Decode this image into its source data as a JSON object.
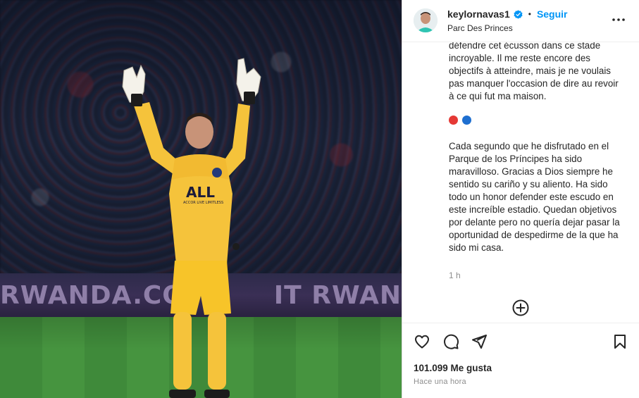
{
  "photo": {
    "banner_text": [
      "RWANDA.COM",
      "IT RWANDA"
    ],
    "shirt_sponsor": "ALL",
    "shirt_sponsor_sub": "ACCOR LIVE LIMITLESS"
  },
  "post": {
    "username": "keylornavas1",
    "separator": "•",
    "follow_label": "Seguir",
    "location": "Parc Des Princes",
    "caption": {
      "french_fragment": "encouragements. Ce fut un honneur de défendre cet écusson dans ce stade incroyable. Il me reste encore des objectifs à atteindre, mais je ne voulais pas manquer l'occasion de dire au revoir à ce qui fut ma maison.",
      "flags": [
        {
          "name": "red-circle",
          "color": "#e53935"
        },
        {
          "name": "blue-circle",
          "color": "#1e6fd0"
        }
      ],
      "spanish": "Cada segundo que he disfrutado en el Parque de los Príncipes ha sido maravilloso. Gracias a Dios siempre he sentido su cariño y su aliento. Ha sido todo un honor defender este escudo en este increíble estadio. Quedan objetivos por delante pero no quería dejar pasar la oportunidad de despedirme de la que ha sido mi casa."
    },
    "caption_age": "1 h",
    "likes": "101.099 Me gusta",
    "posted_ago": "Hace una hora"
  },
  "colors": {
    "accent": "#0095f6",
    "text": "#262626",
    "muted": "#8e8e8e",
    "kit_yellow": "#f5c33b"
  }
}
